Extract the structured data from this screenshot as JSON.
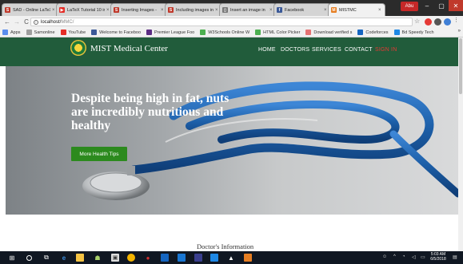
{
  "browser": {
    "tabs": [
      {
        "label": "SAD - Online LaTeX",
        "favicon": "S",
        "color": "#c0392b"
      },
      {
        "label": "LaTeX Tutorial 10 in",
        "favicon": "▶",
        "color": "#e52d27"
      },
      {
        "label": "Inserting Images - ",
        "favicon": "S",
        "color": "#c0392b"
      },
      {
        "label": "Including images in",
        "favicon": "S",
        "color": "#c0392b"
      },
      {
        "label": "Insert an image in",
        "favicon": "▯",
        "color": "#777777"
      },
      {
        "label": "Facebook",
        "favicon": "f",
        "color": "#3b5998"
      },
      {
        "label": "MISTMC",
        "favicon": "M",
        "color": "#e67e22"
      }
    ],
    "profile_label": "Abu",
    "url_host": "localhost/",
    "url_path": "MMC/",
    "bookmarks": [
      {
        "label": "Apps",
        "color": "#5a8dee"
      },
      {
        "label": "Samonline",
        "color": "#9e9e9e"
      },
      {
        "label": "YouTube",
        "color": "#e52d27"
      },
      {
        "label": "Welcome to Faceboo",
        "color": "#3b5998"
      },
      {
        "label": "Premier League Foo",
        "color": "#5b2c83"
      },
      {
        "label": "W3Schools Online W",
        "color": "#4caf50"
      },
      {
        "label": "HTML Color Picker",
        "color": "#4caf50"
      },
      {
        "label": "Download verified s",
        "color": "#e57373"
      },
      {
        "label": "Codeforces",
        "color": "#1565c0"
      },
      {
        "label": "Bd Speedy Tech",
        "color": "#1e88e5"
      }
    ],
    "bookmarks_more": "»"
  },
  "site": {
    "brand": "MIST Medical Center",
    "nav": [
      "HOME",
      "DOCTORS",
      "SERVICES",
      "CONTACT",
      "SIGN IN"
    ],
    "hero_headline": "Despite being high in fat, nuts are incredibly nutritious and healthy",
    "hero_button": "More Health Tips",
    "section_title": "Doctor's Information"
  },
  "taskbar": {
    "time": "5:03 AM",
    "date": "6/5/2018",
    "tray_text": "ENG"
  },
  "colors": {
    "nav_bg": "#215c3b",
    "button_green": "#2c8a1e",
    "signin_red": "#e53935",
    "stethoscope_blue": "#1d5fa8"
  }
}
